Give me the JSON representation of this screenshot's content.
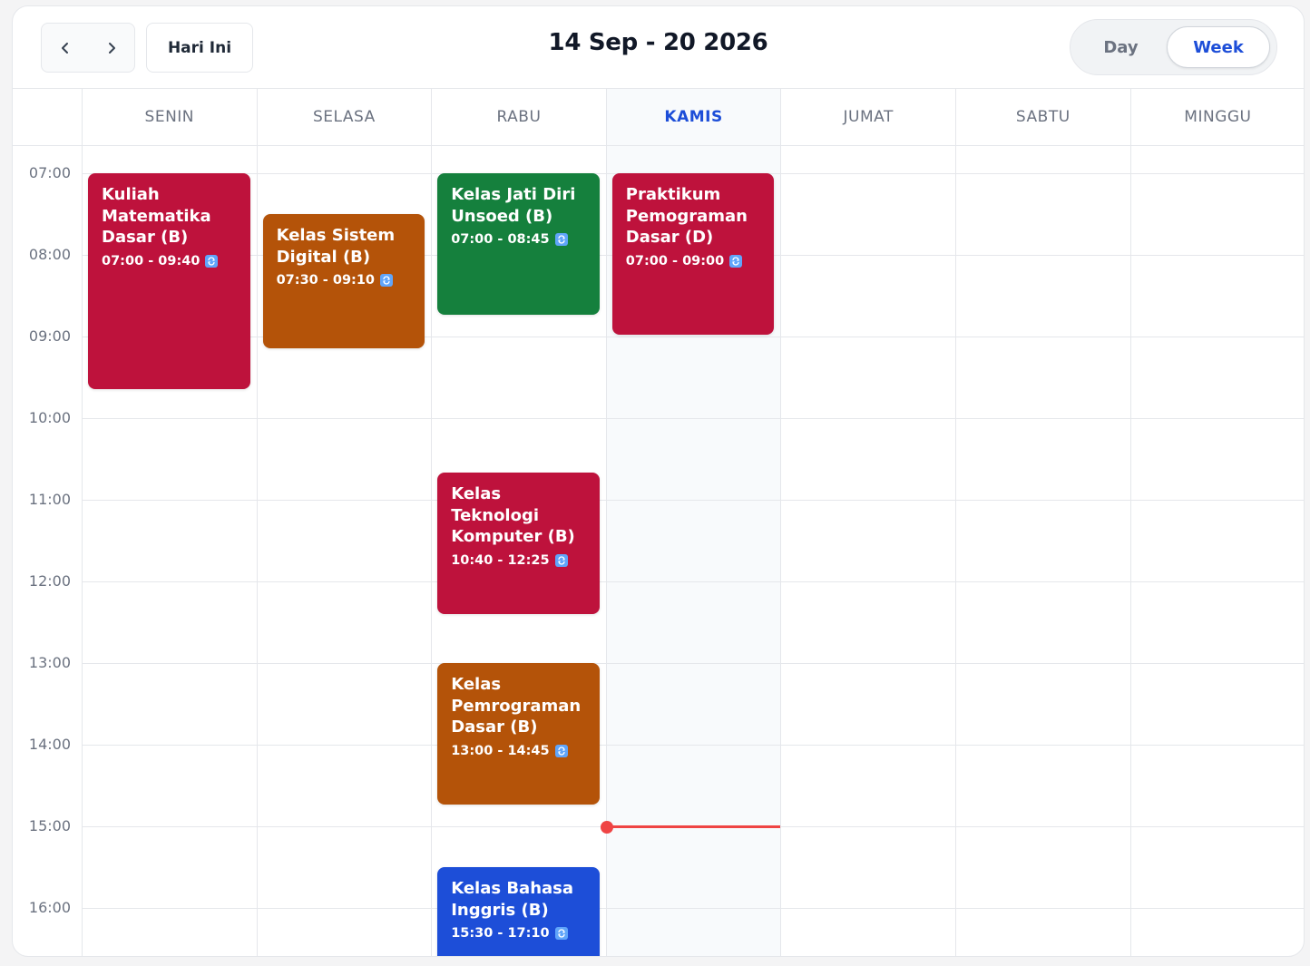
{
  "toolbar": {
    "prev_icon": "chevron-left-icon",
    "next_icon": "chevron-right-icon",
    "today_label": "Hari Ini",
    "range_title": "14 Sep - 20 2026",
    "views": {
      "day": "Day",
      "week": "Week",
      "active": "Week"
    }
  },
  "days": [
    "SENIN",
    "SELASA",
    "RABU",
    "KAMIS",
    "JUMAT",
    "SABTU",
    "MINGGU"
  ],
  "today_index": 3,
  "hours": [
    "07:00",
    "08:00",
    "09:00",
    "10:00",
    "11:00",
    "12:00",
    "13:00",
    "14:00",
    "15:00",
    "16:00"
  ],
  "current_time_indicator": {
    "day_index": 3,
    "time": "15:00"
  },
  "events": [
    {
      "title": "Kuliah Matematika Dasar (B)",
      "time": "07:00 - 09:40",
      "day": "SENIN",
      "color": "#be123c",
      "recurring": true
    },
    {
      "title": "Kelas Sistem Digital (B)",
      "time": "07:30 - 09:10",
      "day": "SELASA",
      "color": "#b45309",
      "recurring": true
    },
    {
      "title": "Kelas Jati Diri Unsoed (B)",
      "time": "07:00 - 08:45",
      "day": "RABU",
      "color": "#15803d",
      "recurring": true
    },
    {
      "title": "Praktikum Pemograman Dasar (D)",
      "time": "07:00 - 09:00",
      "day": "KAMIS",
      "color": "#be123c",
      "recurring": true
    },
    {
      "title": "Kelas Teknologi Komputer (B)",
      "time": "10:40 - 12:25",
      "day": "RABU",
      "color": "#be123c",
      "recurring": true
    },
    {
      "title": "Kelas Pemrograman Dasar (B)",
      "time": "13:00 - 14:45",
      "day": "RABU",
      "color": "#b45309",
      "recurring": true
    },
    {
      "title": "Kelas Bahasa Inggris (B)",
      "time": "15:30 - 17:10",
      "day": "RABU",
      "color": "#1d4ed8",
      "recurring": true
    }
  ],
  "colors": {
    "accent": "#1d4ed8",
    "now_indicator": "#ef4444",
    "recurring_icon": "#60a5fa"
  }
}
